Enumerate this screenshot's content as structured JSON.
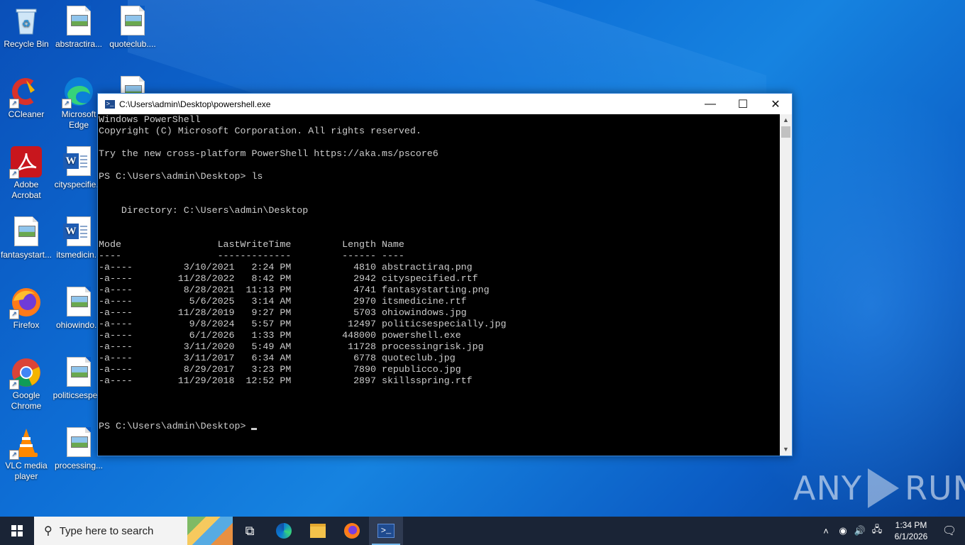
{
  "desktop_icons": [
    {
      "label": "Recycle Bin"
    },
    {
      "label": "abstractira..."
    },
    {
      "label": "quoteclub...."
    },
    {
      "label": "CCleaner"
    },
    {
      "label": "Microsoft Edge"
    },
    {
      "label": "Adobe Acrobat"
    },
    {
      "label": "cityspecifie..."
    },
    {
      "label": "fantasystart..."
    },
    {
      "label": "itsmedicin..."
    },
    {
      "label": "Firefox"
    },
    {
      "label": "ohiowindo..."
    },
    {
      "label": "Google Chrome"
    },
    {
      "label": "politicsespe..."
    },
    {
      "label": "VLC media player"
    },
    {
      "label": "processing..."
    }
  ],
  "window": {
    "title": "C:\\Users\\admin\\Desktop\\powershell.exe",
    "buttons": {
      "minimize": "—",
      "maximize": "☐",
      "close": "✕"
    }
  },
  "console_lines": [
    "Windows PowerShell",
    "Copyright (C) Microsoft Corporation. All rights reserved.",
    "",
    "Try the new cross-platform PowerShell https://aka.ms/pscore6",
    "",
    "PS C:\\Users\\admin\\Desktop> ls",
    "",
    "",
    "    Directory: C:\\Users\\admin\\Desktop",
    "",
    "",
    "Mode                 LastWriteTime         Length Name",
    "----                 -------------         ------ ----",
    "-a----         3/10/2021   2:24 PM           4810 abstractiraq.png",
    "-a----        11/28/2022   8:42 PM           2942 cityspecified.rtf",
    "-a----         8/28/2021  11:13 PM           4741 fantasystarting.png",
    "-a----          5/6/2025   3:14 AM           2970 itsmedicine.rtf",
    "-a----        11/28/2019   9:27 PM           5703 ohiowindows.jpg",
    "-a----          9/8/2024   5:57 PM          12497 politicsespecially.jpg",
    "-a----          6/1/2026   1:33 PM         448000 powershell.exe",
    "-a----         3/11/2020   5:49 AM          11728 processingrisk.jpg",
    "-a----         3/11/2017   6:34 AM           6778 quoteclub.jpg",
    "-a----         8/29/2017   3:23 PM           7890 republicco.jpg",
    "-a----        11/29/2018  12:52 PM           2897 skillsspring.rtf",
    "",
    "",
    ""
  ],
  "prompt": "PS C:\\Users\\admin\\Desktop> ",
  "taskbar": {
    "search_placeholder": "Type here to search",
    "clock_time": "1:34 PM",
    "clock_date": "6/1/2026",
    "items": [
      "task-view-icon",
      "edge-icon",
      "file-explorer-icon",
      "firefox-icon",
      "powershell-icon"
    ]
  },
  "watermark": {
    "left": "ANY",
    "right": "RUN"
  },
  "colors": {
    "desktop": "#0e6fd6",
    "taskbar": "#1a2436",
    "console_bg": "#000000",
    "console_fg": "#cccccc"
  }
}
